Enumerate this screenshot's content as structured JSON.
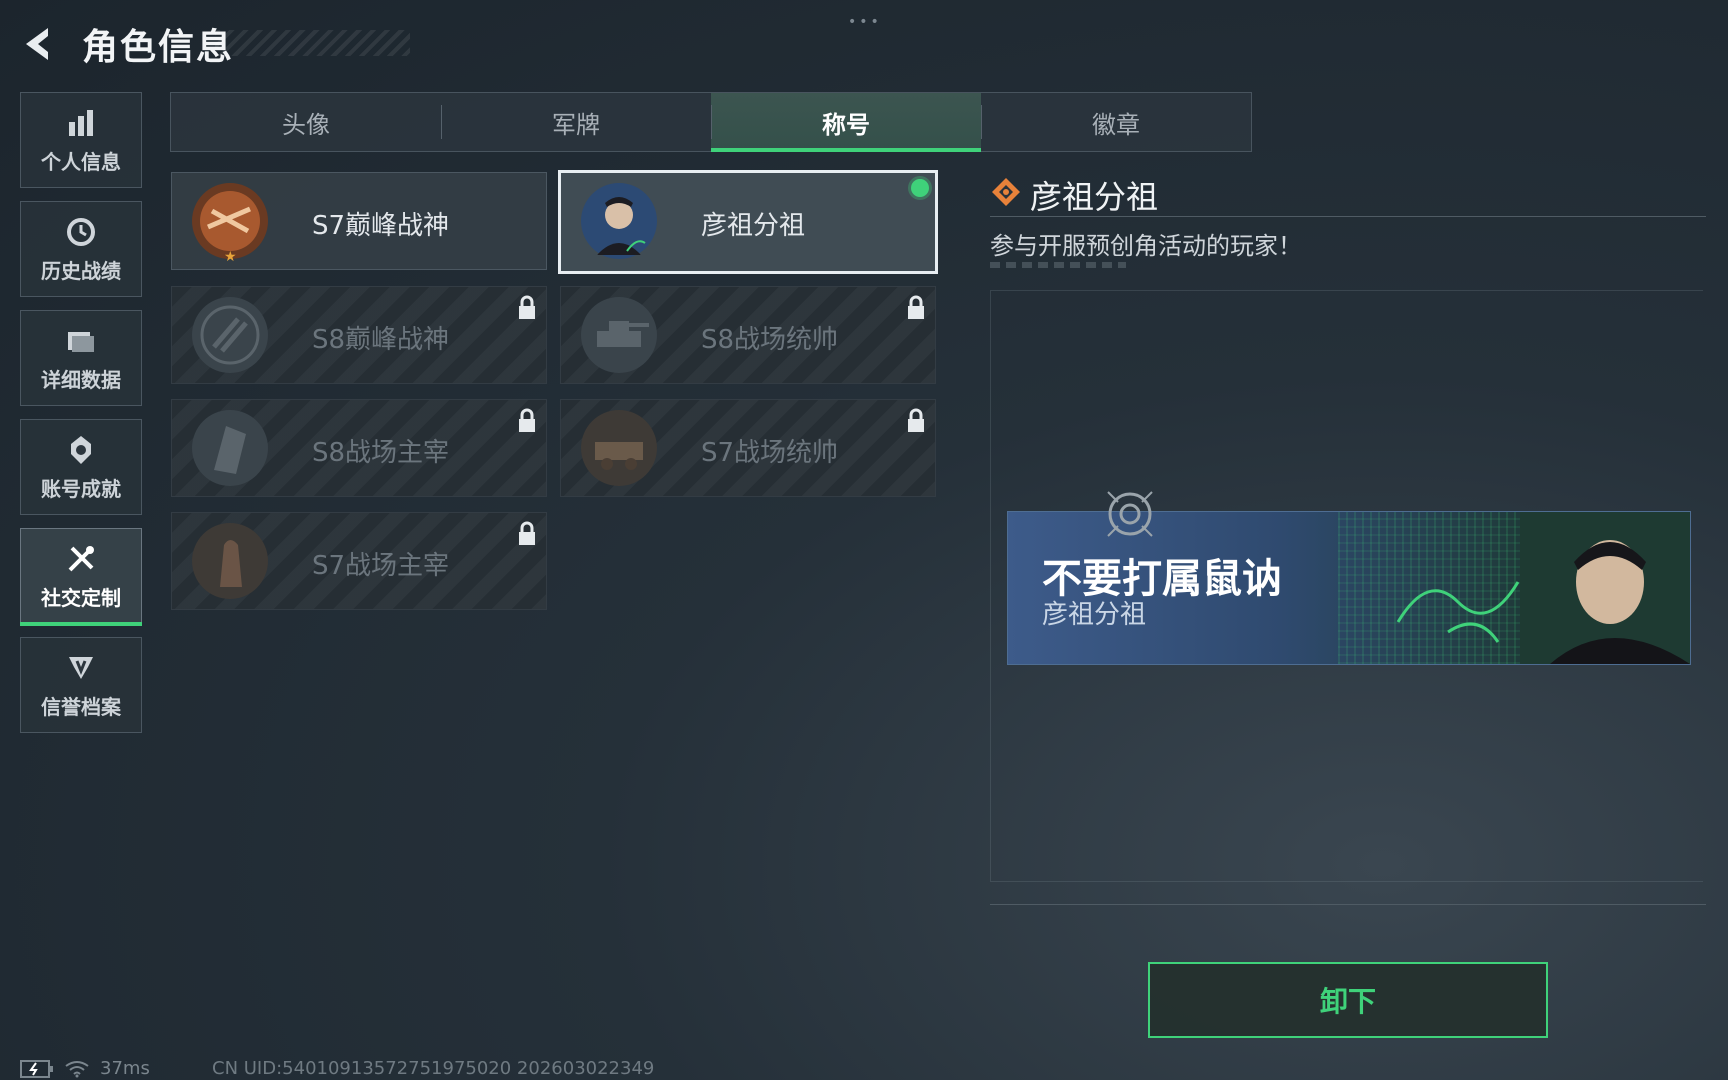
{
  "header": {
    "title": "角色信息",
    "dots": "•••"
  },
  "sidebar": {
    "items": [
      {
        "label": "个人信息",
        "icon": "bar-chart-icon",
        "active": false
      },
      {
        "label": "历史战绩",
        "icon": "history-clock-icon",
        "active": false
      },
      {
        "label": "详细数据",
        "icon": "folder-icon",
        "active": false
      },
      {
        "label": "账号成就",
        "icon": "achievement-medal-icon",
        "active": false
      },
      {
        "label": "社交定制",
        "icon": "tools-icon",
        "active": true
      },
      {
        "label": "信誉档案",
        "icon": "credibility-shield-icon",
        "active": false
      }
    ]
  },
  "tabs": [
    {
      "label": "头像",
      "active": false
    },
    {
      "label": "军牌",
      "active": false
    },
    {
      "label": "称号",
      "active": true
    },
    {
      "label": "徽章",
      "active": false
    }
  ],
  "titles": [
    {
      "name": "S7巅峰战神",
      "locked": false,
      "selected": false,
      "emblem": "crossbow-emblem-icon"
    },
    {
      "name": "彦祖分祖",
      "locked": false,
      "selected": true,
      "equipped": true,
      "emblem": "portrait-emblem-icon"
    },
    {
      "name": "S8巅峰战神",
      "locked": true,
      "emblem": "stripes-emblem-icon"
    },
    {
      "name": "S8战场统帅",
      "locked": true,
      "emblem": "tank-emblem-icon"
    },
    {
      "name": "S8战场主宰",
      "locked": true,
      "emblem": "building-emblem-icon"
    },
    {
      "name": "S7战场统帅",
      "locked": true,
      "emblem": "vehicle-emblem-icon"
    },
    {
      "name": "S7战场主宰",
      "locked": true,
      "emblem": "soldier-emblem-icon"
    }
  ],
  "detail": {
    "title": "彦祖分祖",
    "description": "参与开服预创角活动的玩家！",
    "banner": {
      "player_name": "不要打属鼠讷",
      "title": "彦祖分祖"
    },
    "unequip_label": "卸下"
  },
  "status_bar": {
    "ping": "37ms",
    "uid": "CN UID:540109135727519750​20 202603022349"
  },
  "colors": {
    "accent": "#3fd27a",
    "detail_icon": "#e8823a",
    "star": "#e7a43a"
  }
}
